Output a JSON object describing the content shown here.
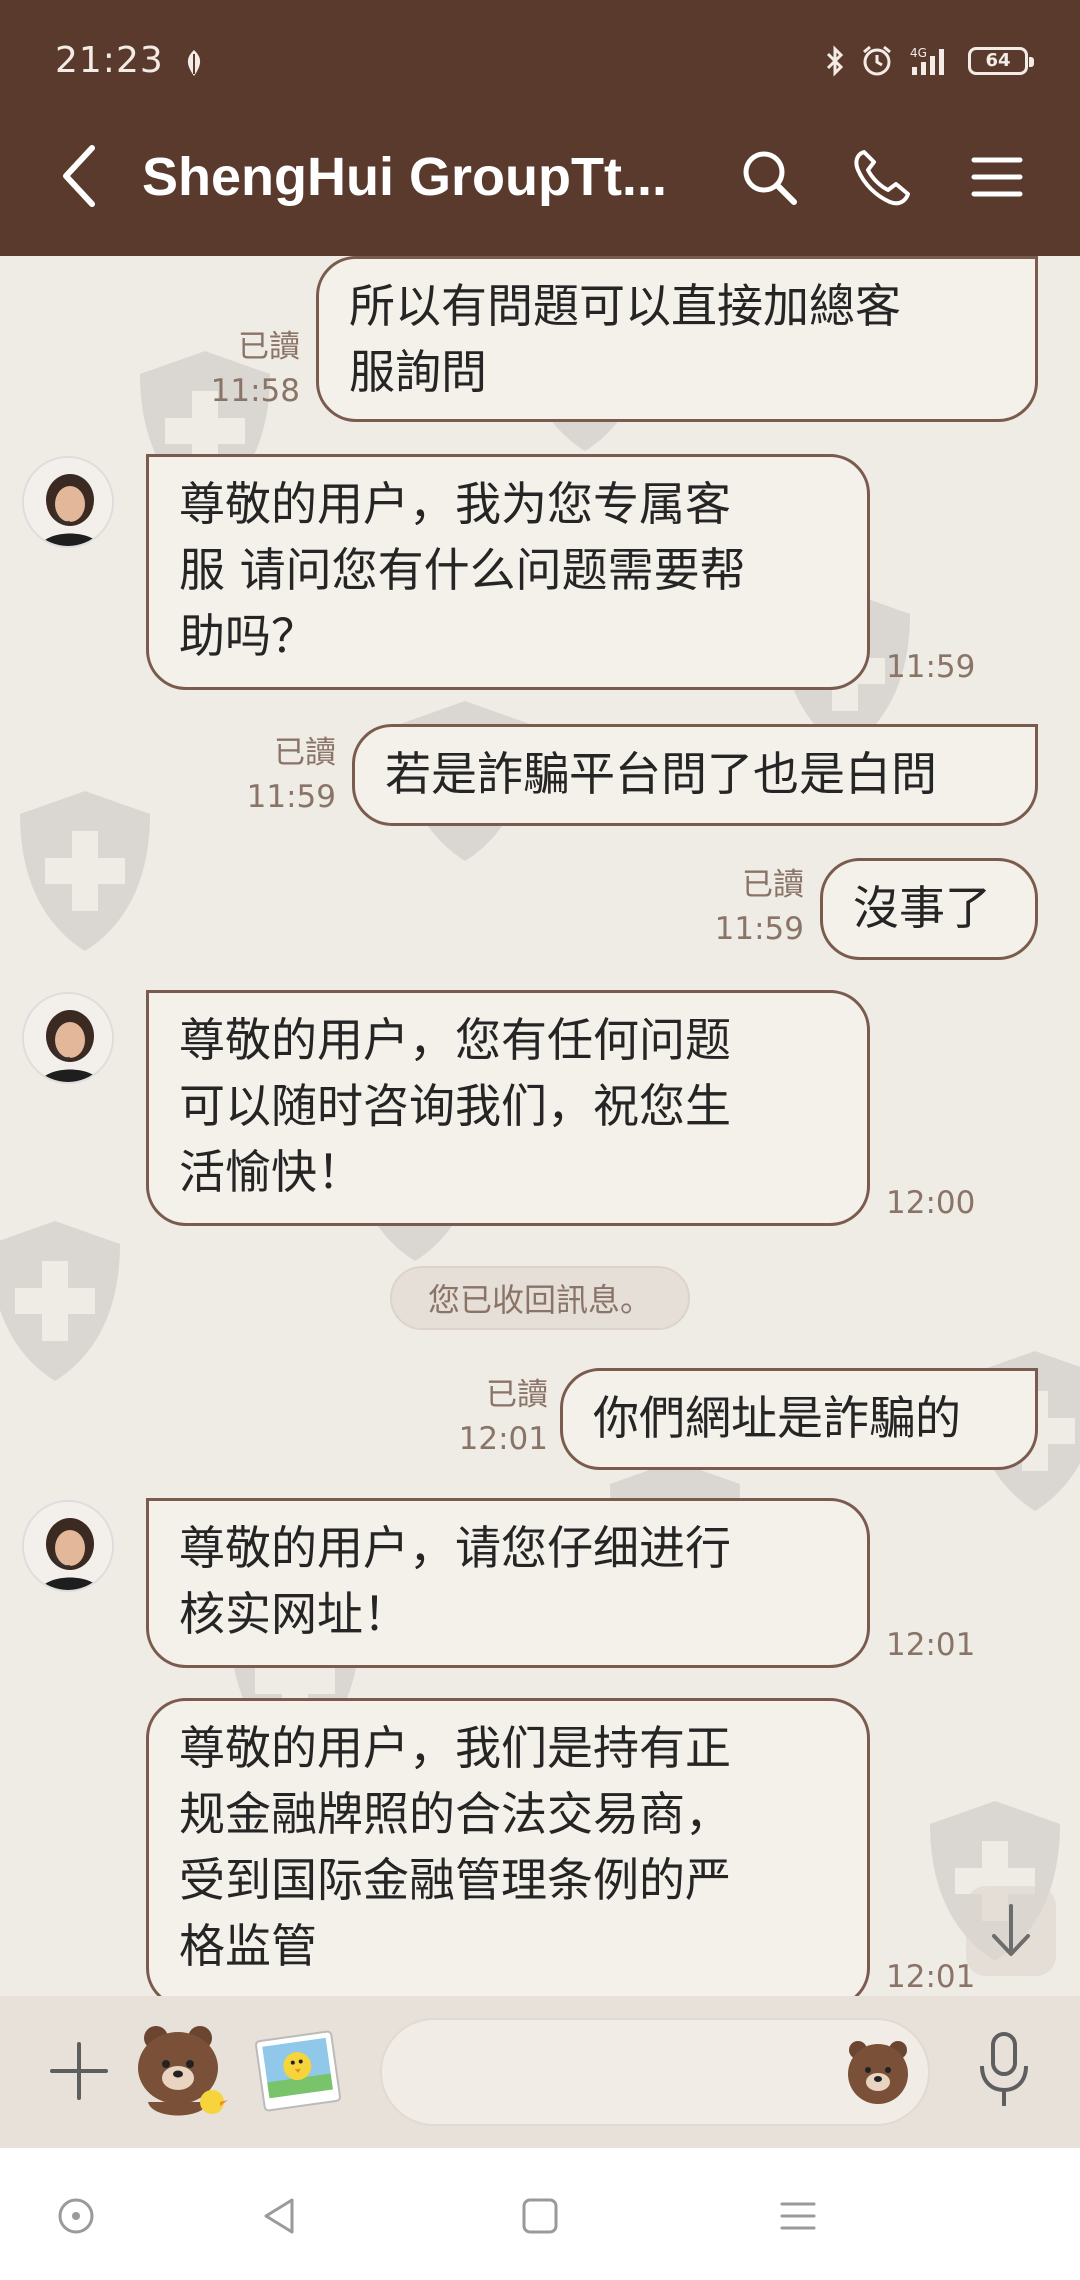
{
  "status_bar": {
    "time": "21:23",
    "network": "4G",
    "battery": "64"
  },
  "header": {
    "title": "ShengHui GroupTt..."
  },
  "messages": [
    {
      "direction": "out",
      "read": "已讀",
      "time": "11:58",
      "lines": [
        "所以有問題可以直接加總客",
        "服詢問"
      ]
    },
    {
      "direction": "in",
      "time": "11:59",
      "lines": [
        "尊敬的用户，我为您专属客",
        "服 请问您有什么问题需要帮",
        "助吗？"
      ]
    },
    {
      "direction": "out",
      "read": "已讀",
      "time": "11:59",
      "lines": [
        "若是詐騙平台問了也是白問"
      ]
    },
    {
      "direction": "out",
      "read": "已讀",
      "time": "11:59",
      "lines": [
        "沒事了"
      ]
    },
    {
      "direction": "in",
      "time": "12:00",
      "lines": [
        "尊敬的用户，您有任何问题",
        "可以随时咨询我们，祝您生",
        "活愉快！"
      ]
    },
    {
      "direction": "out",
      "read": "已讀",
      "time": "12:01",
      "lines": [
        "你們網址是詐騙的"
      ]
    },
    {
      "direction": "in",
      "time": "12:01",
      "lines": [
        "尊敬的用户，请您仔细进行",
        "核实网址！"
      ]
    },
    {
      "direction": "in",
      "time": "12:01",
      "lines": [
        "尊敬的用户，我们是持有正",
        "规金融牌照的合法交易商，",
        "受到国际金融管理条例的严",
        "格监管"
      ]
    }
  ],
  "system_message": "您已收回訊息。",
  "icons": {
    "back": "back-arrow-icon",
    "search": "search-icon",
    "call": "phone-icon",
    "menu": "menu-icon",
    "plus": "plus-icon",
    "emoji": "bear-emoji-icon",
    "mic": "microphone-icon",
    "scroll": "arrow-down-icon"
  },
  "colors": {
    "header_bg": "#5a3a2c",
    "chat_bg": "#efebe5",
    "bubble_border": "#7a5b4e"
  }
}
